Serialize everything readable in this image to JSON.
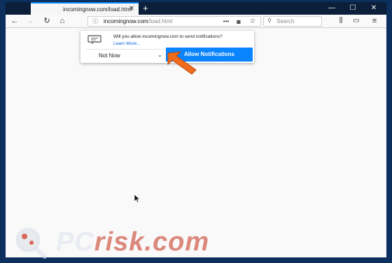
{
  "browser": {
    "tab_title": "incomingnow.com/load.html",
    "tab_close": "✕",
    "new_tab": "+",
    "window_controls": [
      "—",
      "☐",
      "✕"
    ]
  },
  "toolbar": {
    "url_host": "incomingnow.com",
    "url_path": "/load.html",
    "page_actions": "•••",
    "search_placeholder": "Search"
  },
  "notification": {
    "question": "Will you allow incomingnow.com to send notifications?",
    "learn_more": "Learn More...",
    "select_value": "Not Now",
    "allow_button": "Allow Notifications"
  },
  "watermark": {
    "text_pc": "PC",
    "text_risk": "risk.com"
  },
  "colors": {
    "accent": "#0a84ff",
    "frame": "#0c2f5e",
    "arrow": "#f26c1d"
  }
}
